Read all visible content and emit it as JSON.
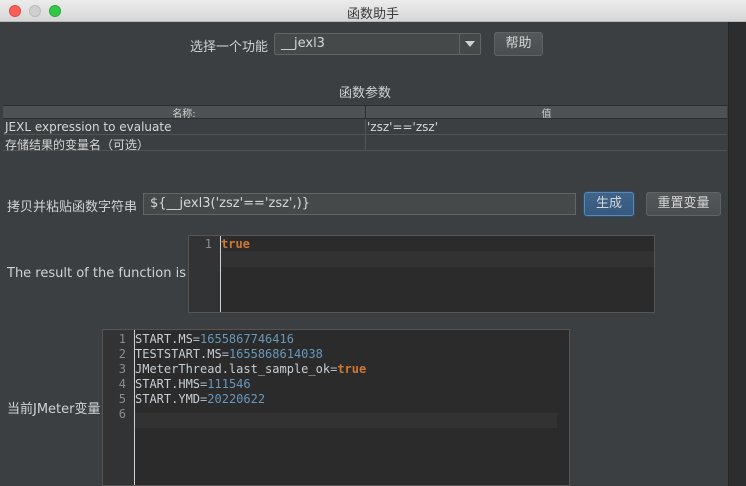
{
  "window": {
    "title": "函数助手"
  },
  "function_select": {
    "label": "选择一个功能",
    "selected": "__jexl3",
    "help_label": "帮助"
  },
  "params": {
    "section_title": "函数参数",
    "columns": [
      "名称:",
      "值"
    ],
    "rows": [
      {
        "name": "JEXL expression to evaluate",
        "value": "'zsz'=='zsz'"
      },
      {
        "name": "存储结果的变量名（可选）",
        "value": ""
      }
    ]
  },
  "copy_paste": {
    "label": "拷贝并粘贴函数字符串",
    "value": "${__jexl3('zsz'=='zsz',)}",
    "generate_label": "生成",
    "reset_label": "重置变量"
  },
  "result": {
    "label": "The result of the function is",
    "lines": [
      {
        "n": "1",
        "value": "true"
      }
    ]
  },
  "jmeter_vars": {
    "label": "当前JMeter变量",
    "lines": [
      {
        "n": "1",
        "key": "START.MS",
        "value": "1655867746416"
      },
      {
        "n": "2",
        "key": "TESTSTART.MS",
        "value": "1655868614038"
      },
      {
        "n": "3",
        "key": "JMeterThread.last_sample_ok",
        "value": "true"
      },
      {
        "n": "4",
        "key": "START.HMS",
        "value": "111546"
      },
      {
        "n": "5",
        "key": "START.YMD",
        "value": "20220622"
      },
      {
        "n": "6",
        "key": "",
        "value": ""
      }
    ]
  }
}
